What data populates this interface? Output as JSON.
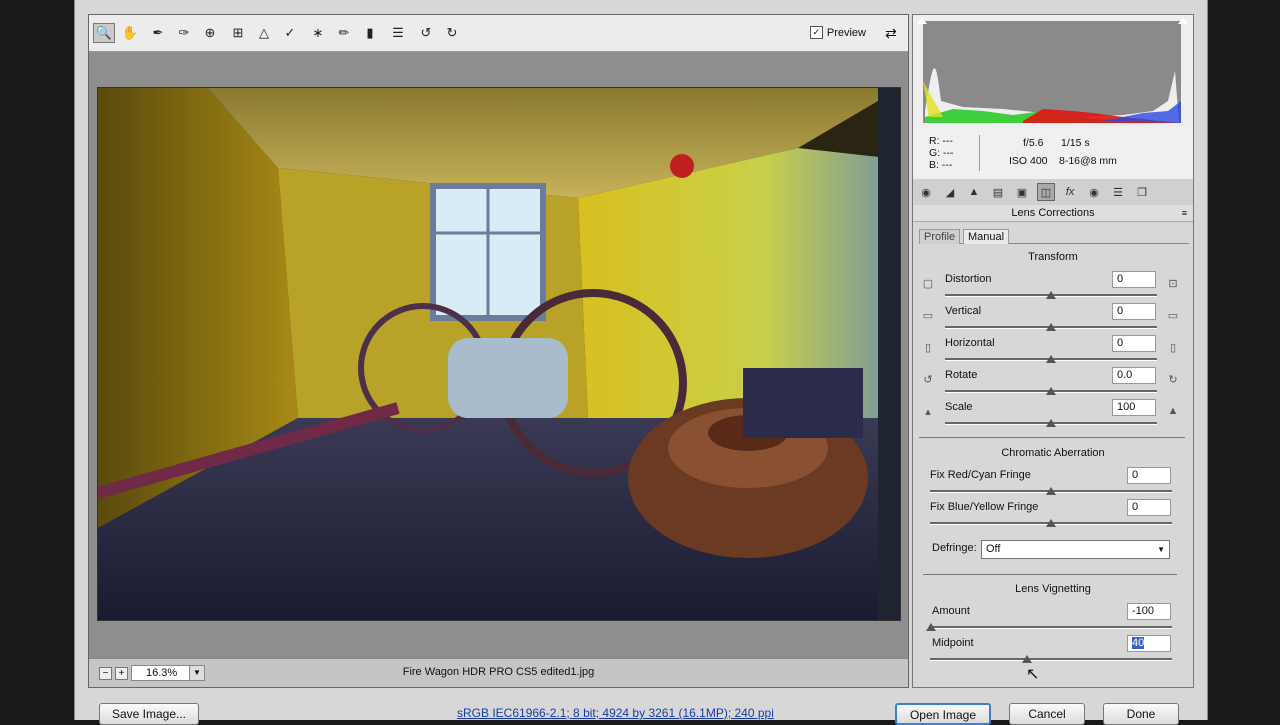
{
  "toolbar": {
    "tools": [
      "zoom-icon",
      "hand-icon",
      "white-balance-icon",
      "color-sampler-icon",
      "targeted-adjustment-icon",
      "crop-icon",
      "straighten-icon",
      "spot-removal-icon",
      "red-eye-icon",
      "adjustment-brush-icon",
      "graduated-filter-icon",
      "preferences-icon",
      "rotate-left-icon",
      "rotate-right-icon"
    ],
    "preview_label": "Preview",
    "preview_checked": true
  },
  "status": {
    "zoom": "16.3%",
    "filename": "Fire Wagon HDR PRO CS5 edited1.jpg"
  },
  "info": {
    "r_label": "R:",
    "g_label": "G:",
    "b_label": "B:",
    "r": "---",
    "g": "---",
    "b": "---",
    "aperture": "f/5.6",
    "shutter": "1/15 s",
    "iso": "ISO 400",
    "lens": "8-16@8 mm"
  },
  "panel": {
    "title": "Lens Corrections",
    "tabs": [
      "Profile",
      "Manual"
    ],
    "active_tab": "Manual",
    "transform": {
      "title": "Transform",
      "rows": [
        {
          "label": "Distortion",
          "value": "0",
          "level": 0.5
        },
        {
          "label": "Vertical",
          "value": "0",
          "level": 0.5
        },
        {
          "label": "Horizontal",
          "value": "0",
          "level": 0.5
        },
        {
          "label": "Rotate",
          "value": "0.0",
          "level": 0.5
        },
        {
          "label": "Scale",
          "value": "100",
          "level": 0.5
        }
      ]
    },
    "chromatic": {
      "title": "Chromatic Aberration",
      "rows": [
        {
          "label": "Fix Red/Cyan Fringe",
          "value": "0",
          "level": 0.5
        },
        {
          "label": "Fix Blue/Yellow Fringe",
          "value": "0",
          "level": 0.5
        }
      ],
      "defringe_label": "Defringe:",
      "defringe_value": "Off"
    },
    "vignetting": {
      "title": "Lens Vignetting",
      "rows": [
        {
          "label": "Amount",
          "value": "-100",
          "level": 0.0
        },
        {
          "label": "Midpoint",
          "value": "40",
          "level": 0.4
        }
      ]
    }
  },
  "footer": {
    "save_label": "Save Image...",
    "workflow_link": "sRGB IEC61966-2.1; 8 bit; 4924 by 3261 (16.1MP); 240 ppi",
    "open_label": "Open Image",
    "cancel_label": "Cancel",
    "done_label": "Done"
  }
}
